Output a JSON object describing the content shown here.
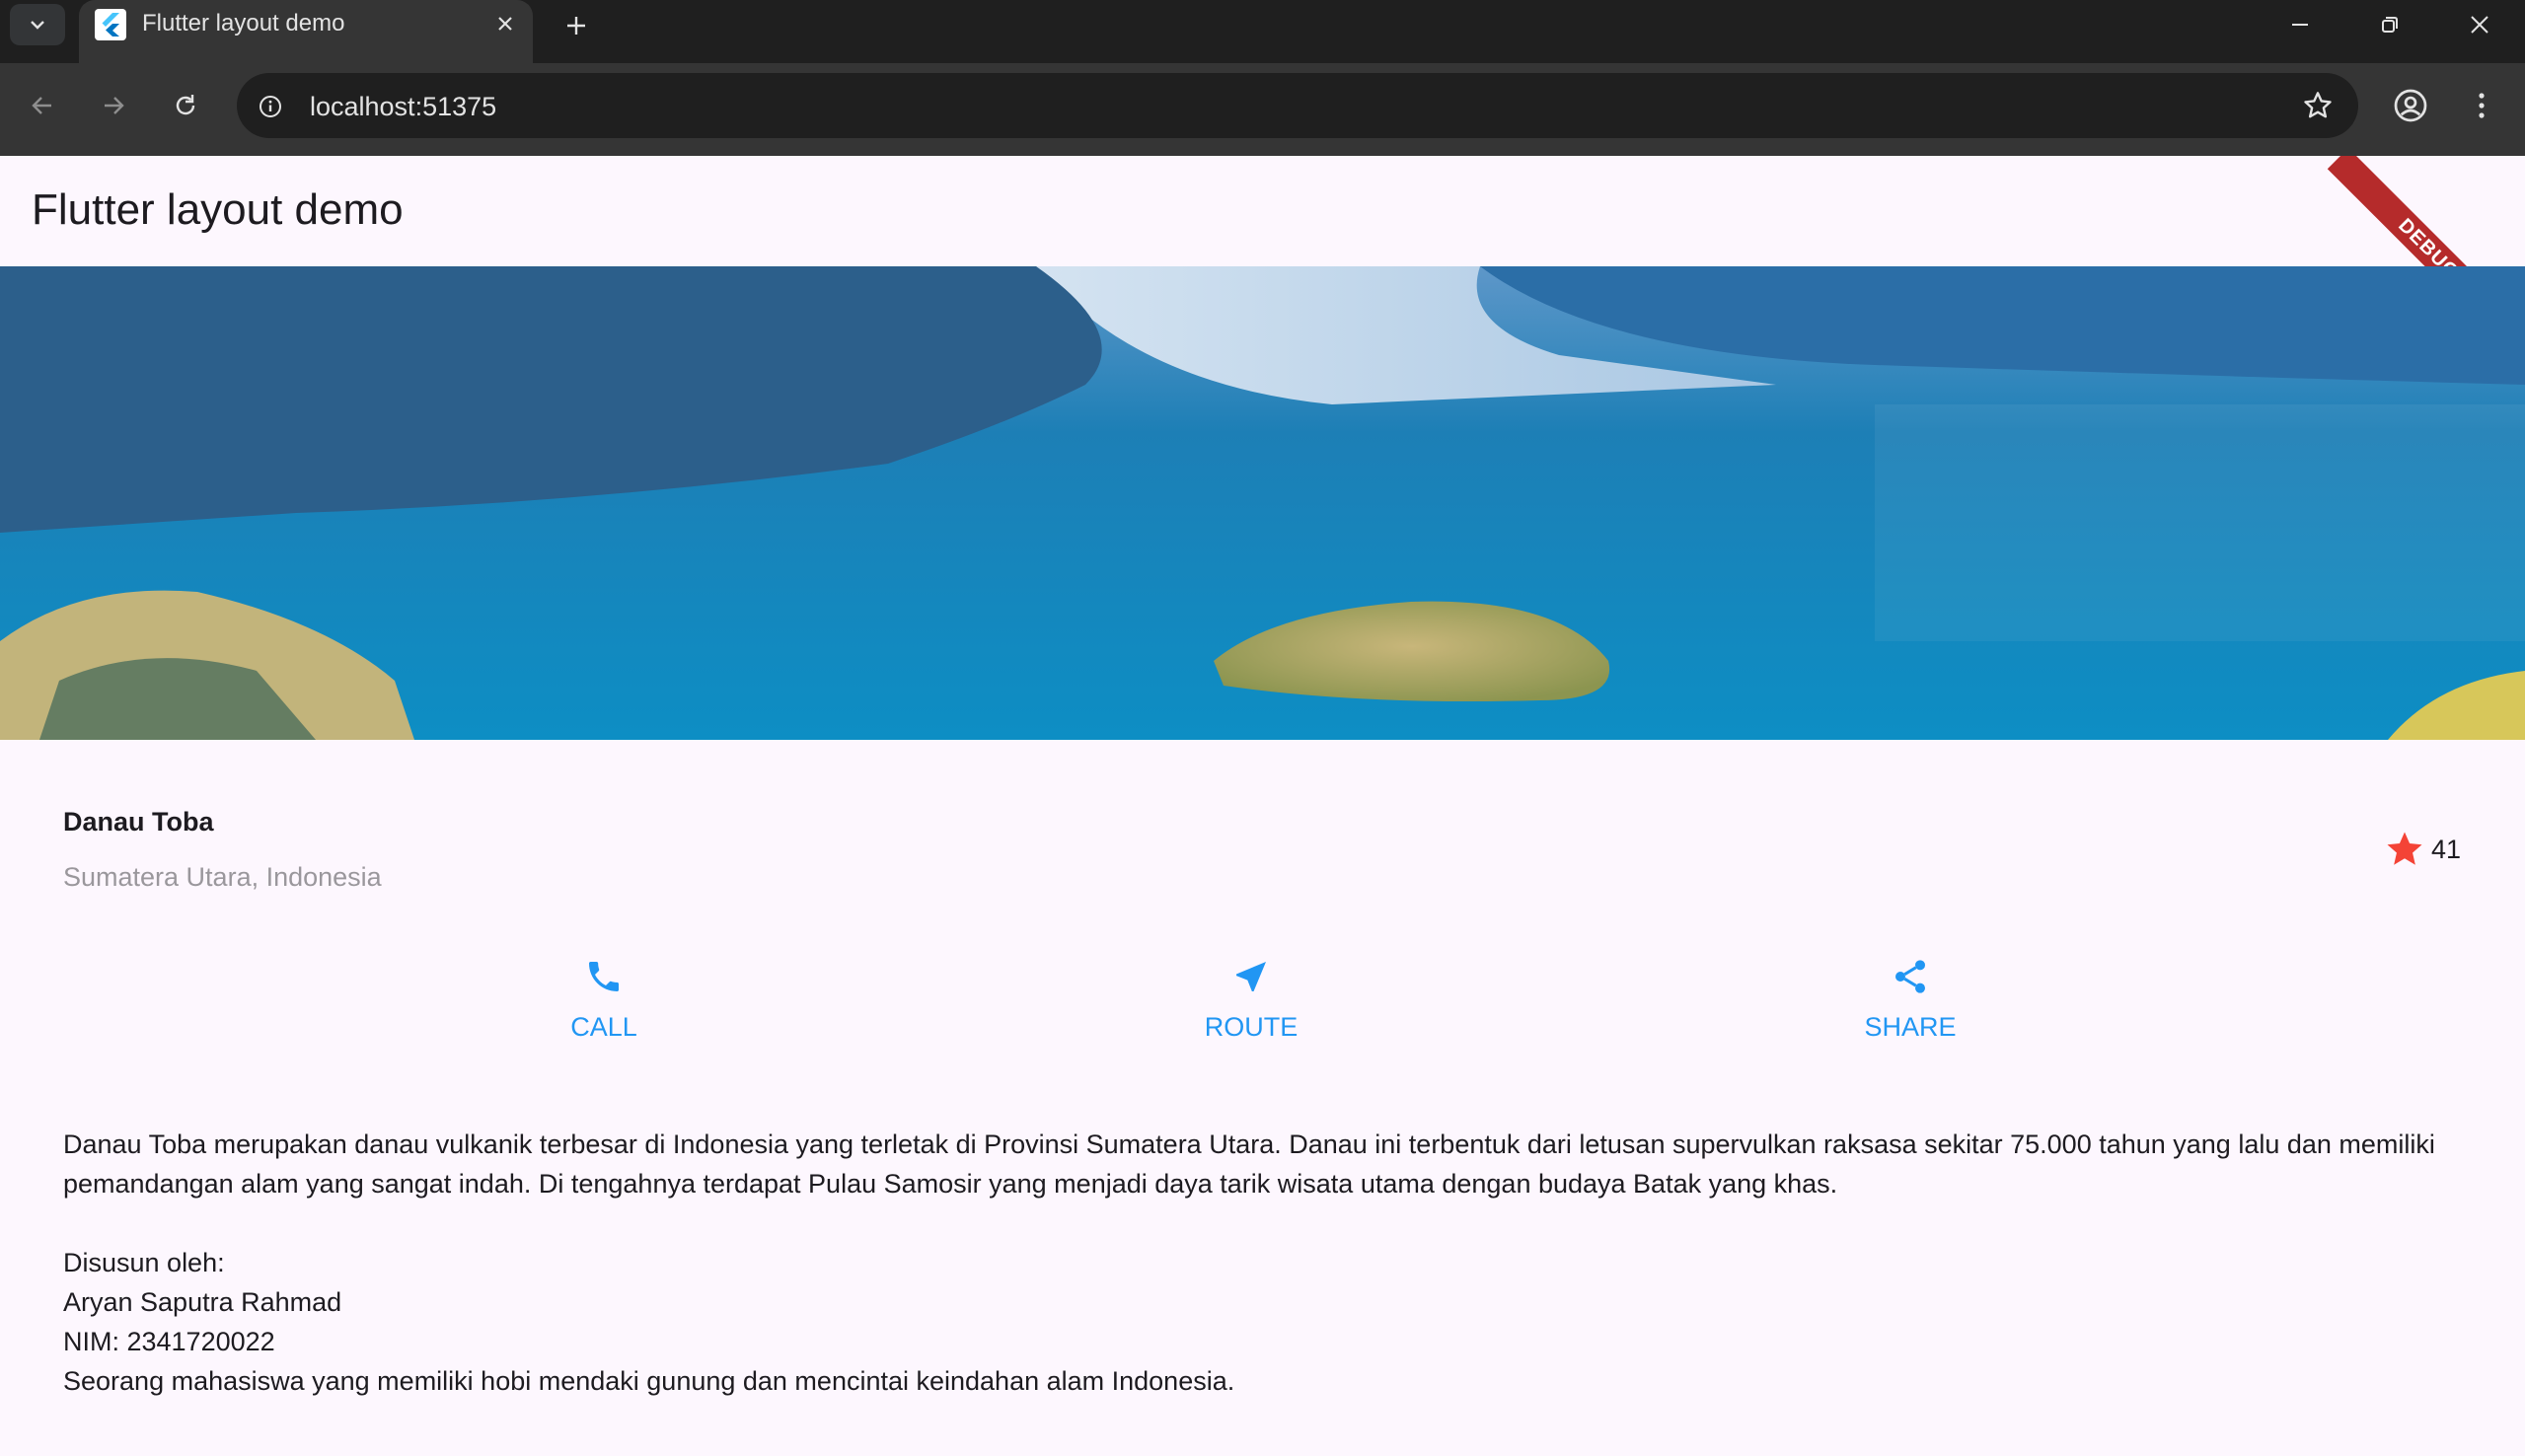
{
  "browser": {
    "tab_title": "Flutter layout demo",
    "url": "localhost:51375"
  },
  "app": {
    "title": "Flutter layout demo",
    "debug_banner": "DEBUG",
    "place": {
      "name": "Danau Toba",
      "region": "Sumatera Utara, Indonesia",
      "rating_count": "41"
    },
    "actions": [
      {
        "label": "CALL",
        "icon": "phone-icon"
      },
      {
        "label": "ROUTE",
        "icon": "near-me-icon"
      },
      {
        "label": "SHARE",
        "icon": "share-icon"
      }
    ],
    "description": "Danau Toba merupakan danau vulkanik terbesar di Indonesia yang terletak di Provinsi Sumatera Utara. Danau ini terbentuk dari letusan supervulkan raksasa sekitar 75.000 tahun yang lalu dan memiliki pemandangan alam yang sangat indah. Di tengahnya terdapat Pulau Samosir yang menjadi daya tarik wisata utama dengan budaya Batak yang khas.\n\nDisusun oleh:\nAryan Saputra Rahmad\nNIM: 2341720022\nSeorang mahasiswa yang memiliki hobi mendaki gunung dan mencintai keindahan alam Indonesia."
  },
  "colors": {
    "accent": "#2196f3",
    "star": "#f44336",
    "background": "#fdf7fe",
    "chrome_dark": "#1f1f1f",
    "chrome_toolbar": "#353535"
  }
}
